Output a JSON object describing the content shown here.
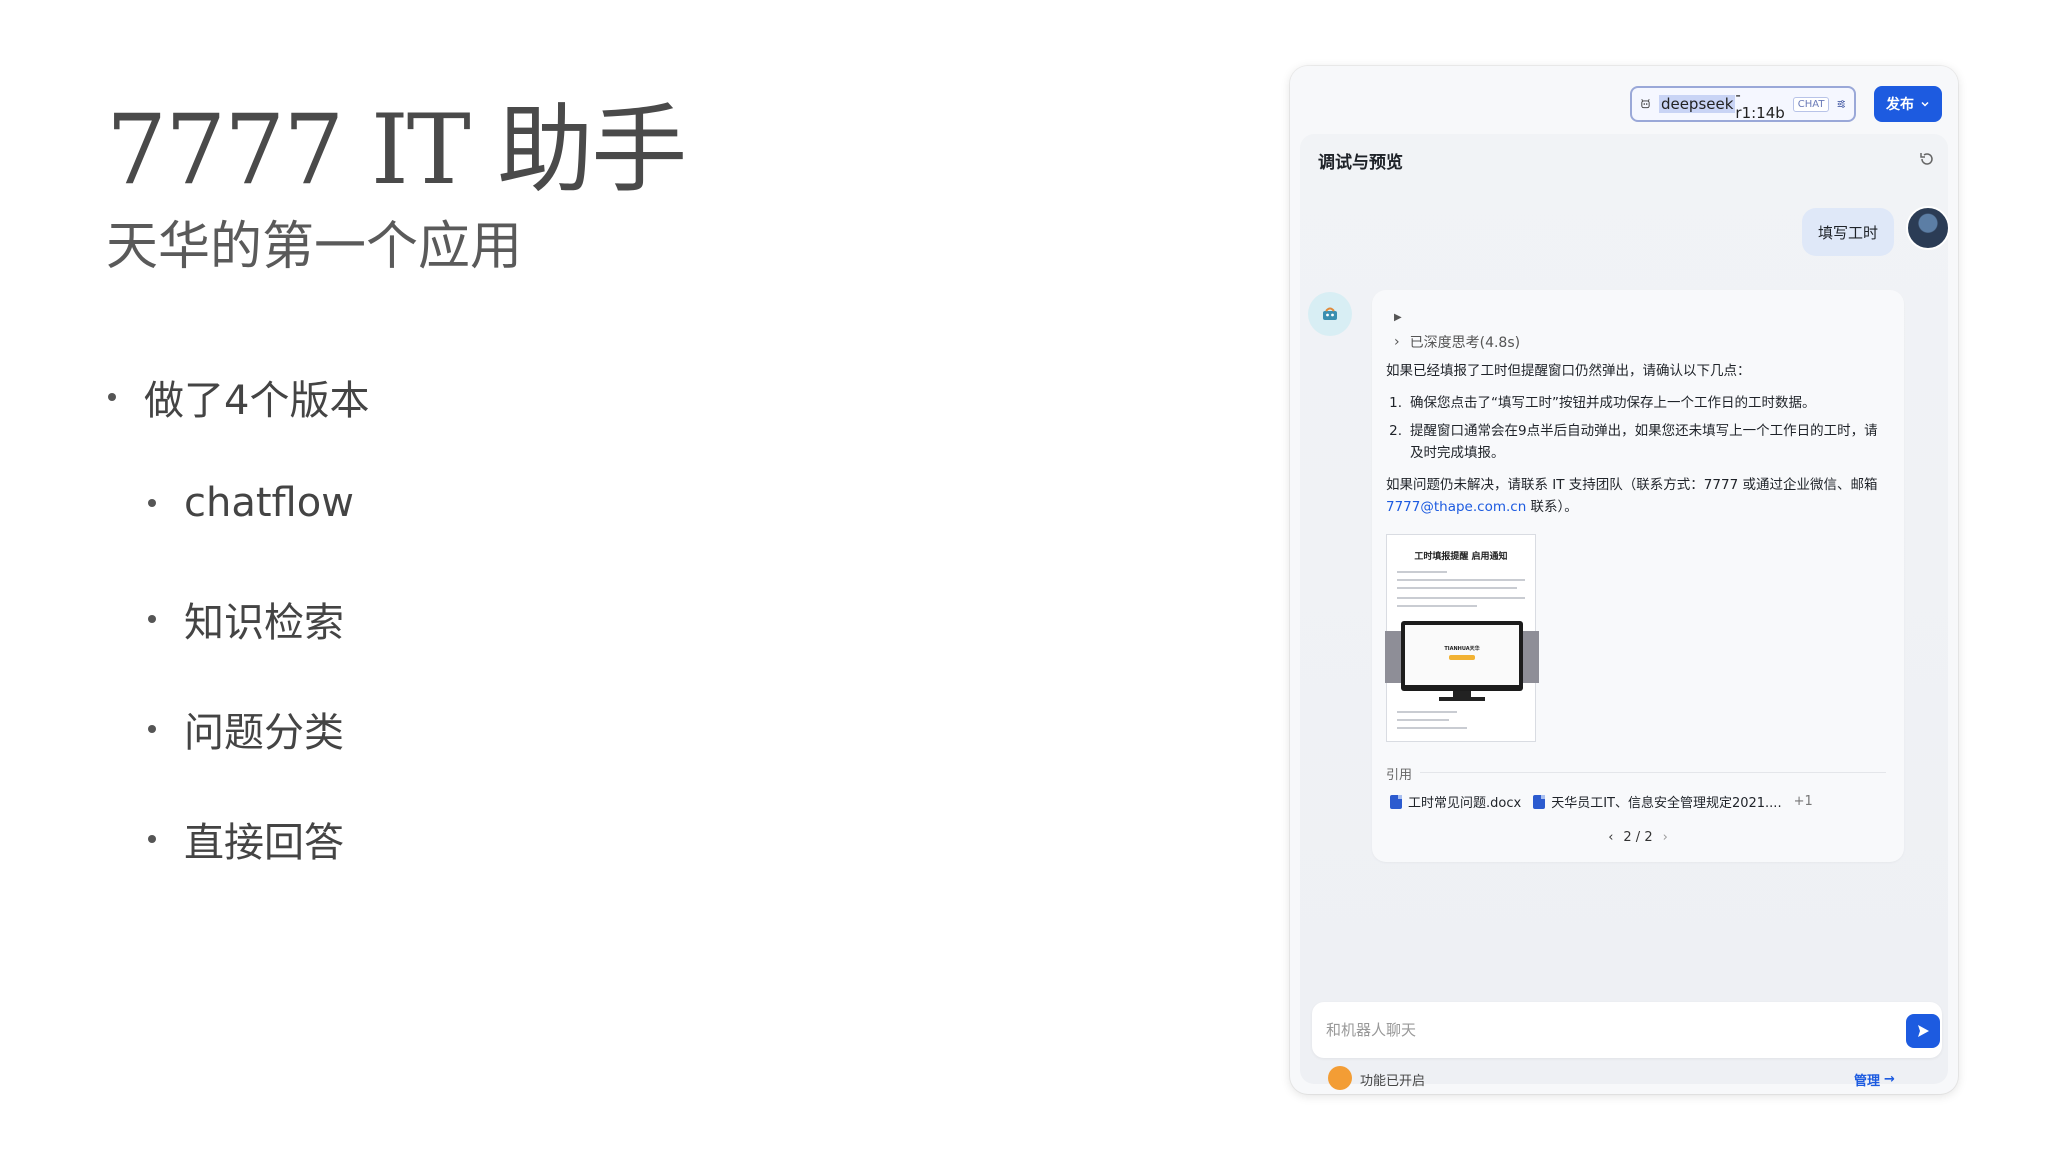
{
  "slide": {
    "title": "7777 IT 助手",
    "subtitle": "天华的第一个应用",
    "bullets": [
      "做了4个版本",
      "chatflow",
      "知识检索",
      "问题分类",
      "直接回答"
    ]
  },
  "app": {
    "model": {
      "name": "deepseek",
      "suffix": "-r1:14b",
      "badge": "CHAT"
    },
    "publish_label": "发布",
    "panel_title": "调试与预览",
    "user_message": "填写工时",
    "answer": {
      "thinking_label": "已深度思考(4.8s)",
      "intro": "如果已经填报了工时但提醒窗口仍然弹出，请确认以下几点：",
      "steps": [
        "确保您点击了“填写工时”按钮并成功保存上一个工作日的工时数据。",
        "提醒窗口通常会在9点半后自动弹出，如果您还未填写上一个工作日的工时，请及时完成填报。"
      ],
      "follow_prefix": "如果问题仍未解决，请联系 IT 支持团队（联系方式：7777 或通过企业微信、邮箱 ",
      "follow_email": "7777@thape.com.cn",
      "follow_suffix": " 联系）。",
      "image_title": "工时填报提醒 启用通知",
      "image_brand": "TIANHUA天华"
    },
    "references": {
      "label": "引用",
      "files": [
        "工时常见问题.docx",
        "天华员工IT、信息安全管理规定2021...."
      ],
      "more": "+1"
    },
    "pager": "2 / 2",
    "input_placeholder": "和机器人聊天",
    "feature_label": "功能已开启",
    "manage_label": "管理"
  },
  "colors": {
    "accent": "#1d5be0",
    "feature": "#f39d35"
  }
}
